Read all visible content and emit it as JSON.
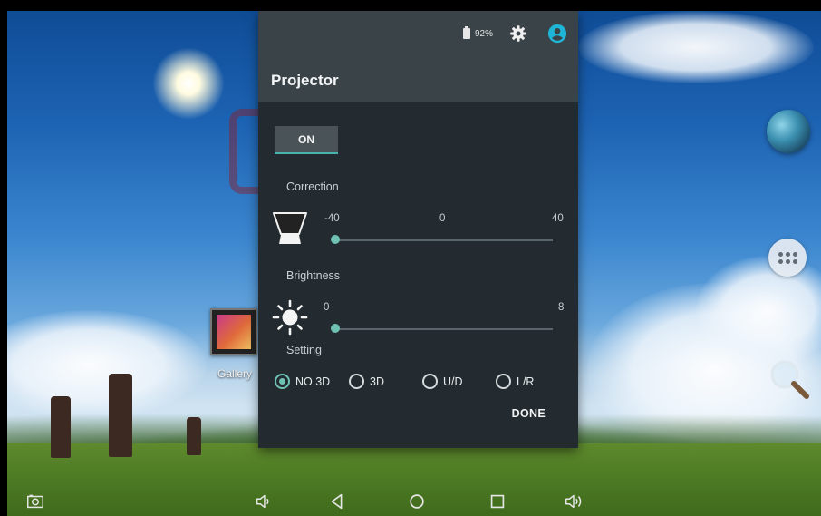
{
  "desktop": {
    "gallery_label": "Gallery"
  },
  "status_bar": {
    "battery_percent": "92%"
  },
  "panel": {
    "title": "Projector",
    "toggle_label": "ON",
    "correction": {
      "label": "Correction",
      "min_label": "-40",
      "mid_label": "0",
      "max_label": "40",
      "min": -40,
      "max": 40,
      "value": -40
    },
    "brightness": {
      "label": "Brightness",
      "min_label": "0",
      "max_label": "8",
      "min": 0,
      "max": 8,
      "value": 0
    },
    "setting": {
      "label": "Setting",
      "options": [
        "NO 3D",
        "3D",
        "U/D",
        "L/R"
      ],
      "selected": "NO 3D"
    },
    "done_label": "DONE"
  },
  "colors": {
    "accent": "#6fc1b3",
    "panel_bg": "#232b30",
    "header_bg": "#3a4348",
    "account_icon": "#1fb5d6"
  },
  "icons": {
    "status": [
      "battery-icon",
      "gear-icon",
      "account-icon"
    ],
    "navbar": [
      "screenshot-icon",
      "volume-down-icon",
      "back-icon",
      "home-icon",
      "recents-icon",
      "volume-up-icon"
    ],
    "desktop": [
      "globe-icon",
      "apps-icon",
      "search-icon",
      "gallery-icon"
    ]
  }
}
